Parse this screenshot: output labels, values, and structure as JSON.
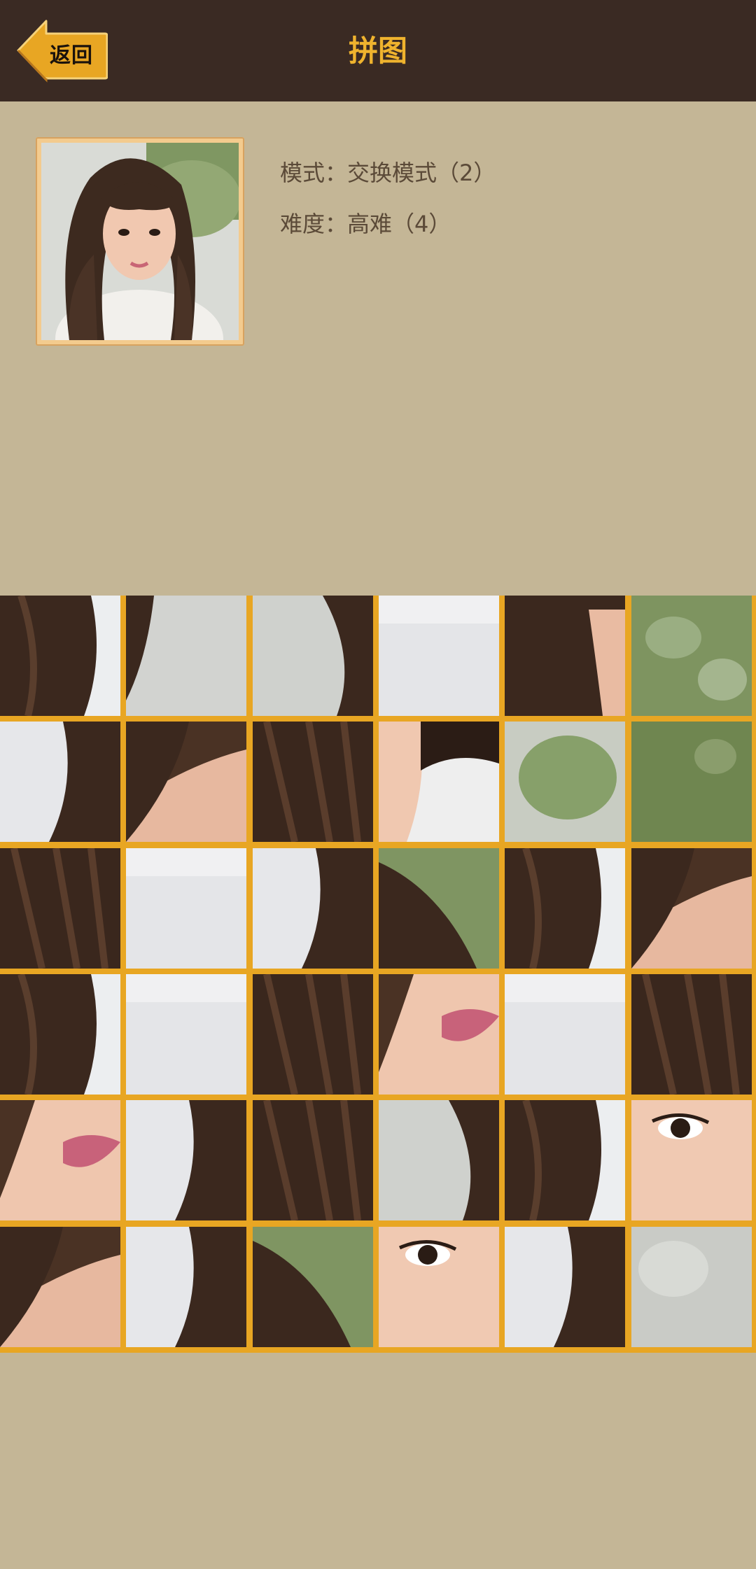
{
  "header": {
    "title": "拼图",
    "back_label": "返回"
  },
  "info": {
    "mode_label": "模式：",
    "mode_value": "交换模式（2）",
    "difficulty_label": "难度：",
    "difficulty_value": "高难（4）"
  },
  "colors": {
    "topbar": "#3a2a23",
    "title": "#efb32e",
    "background": "#c4b696",
    "grid_lines": "#e8a623",
    "back_button": "#e8a623"
  },
  "puzzle": {
    "rows": 6,
    "cols": 6,
    "tiles": [
      {
        "theme": "hair-white"
      },
      {
        "theme": "hair-gray"
      },
      {
        "theme": "gray-hair"
      },
      {
        "theme": "white"
      },
      {
        "theme": "hair-face"
      },
      {
        "theme": "green"
      },
      {
        "theme": "white-hair"
      },
      {
        "theme": "hair-skin"
      },
      {
        "theme": "hair-dark"
      },
      {
        "theme": "skin-white"
      },
      {
        "theme": "green-gray"
      },
      {
        "theme": "green-dark"
      },
      {
        "theme": "hair-dark"
      },
      {
        "theme": "white"
      },
      {
        "theme": "white-hair"
      },
      {
        "theme": "green-hair"
      },
      {
        "theme": "hair-white"
      },
      {
        "theme": "hair-skin"
      },
      {
        "theme": "hair-white"
      },
      {
        "theme": "white"
      },
      {
        "theme": "hair-dark"
      },
      {
        "theme": "skin-lips"
      },
      {
        "theme": "white"
      },
      {
        "theme": "hair-dark"
      },
      {
        "theme": "skin-lips"
      },
      {
        "theme": "white-hair"
      },
      {
        "theme": "hair-dark"
      },
      {
        "theme": "gray-hair"
      },
      {
        "theme": "hair-white"
      },
      {
        "theme": "skin-eye"
      },
      {
        "theme": "hair-skin"
      },
      {
        "theme": "white-hair"
      },
      {
        "theme": "green-hair"
      },
      {
        "theme": "skin-eye"
      },
      {
        "theme": "white-hair"
      },
      {
        "theme": "gray"
      }
    ]
  }
}
